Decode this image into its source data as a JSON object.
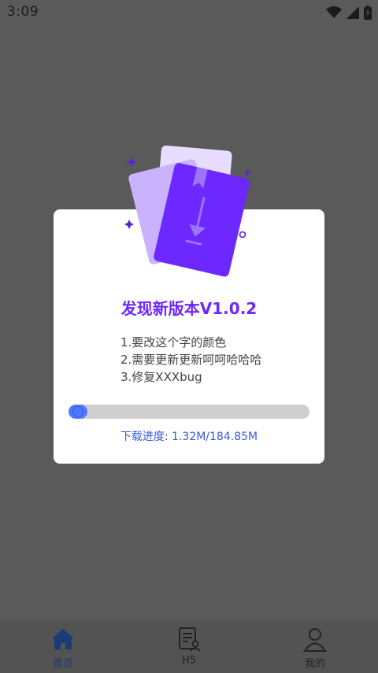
{
  "status_bar": {
    "time": "3:09"
  },
  "dialog": {
    "title": "发现新版本V1.0.2",
    "notes": [
      "1.要改这个字的颜色",
      "2.需要更新更新呵呵哈哈哈",
      "3.修复XXXbug"
    ],
    "progress": {
      "fraction": 0.007,
      "text": "下载进度: 1.32M/184.85M"
    },
    "accent_color": "#6d28ff"
  },
  "tabs": [
    {
      "label": "首页",
      "icon": "home-icon",
      "active": true
    },
    {
      "label": "H5",
      "icon": "document-user-icon",
      "active": false
    },
    {
      "label": "我的",
      "icon": "person-icon",
      "active": false
    }
  ]
}
